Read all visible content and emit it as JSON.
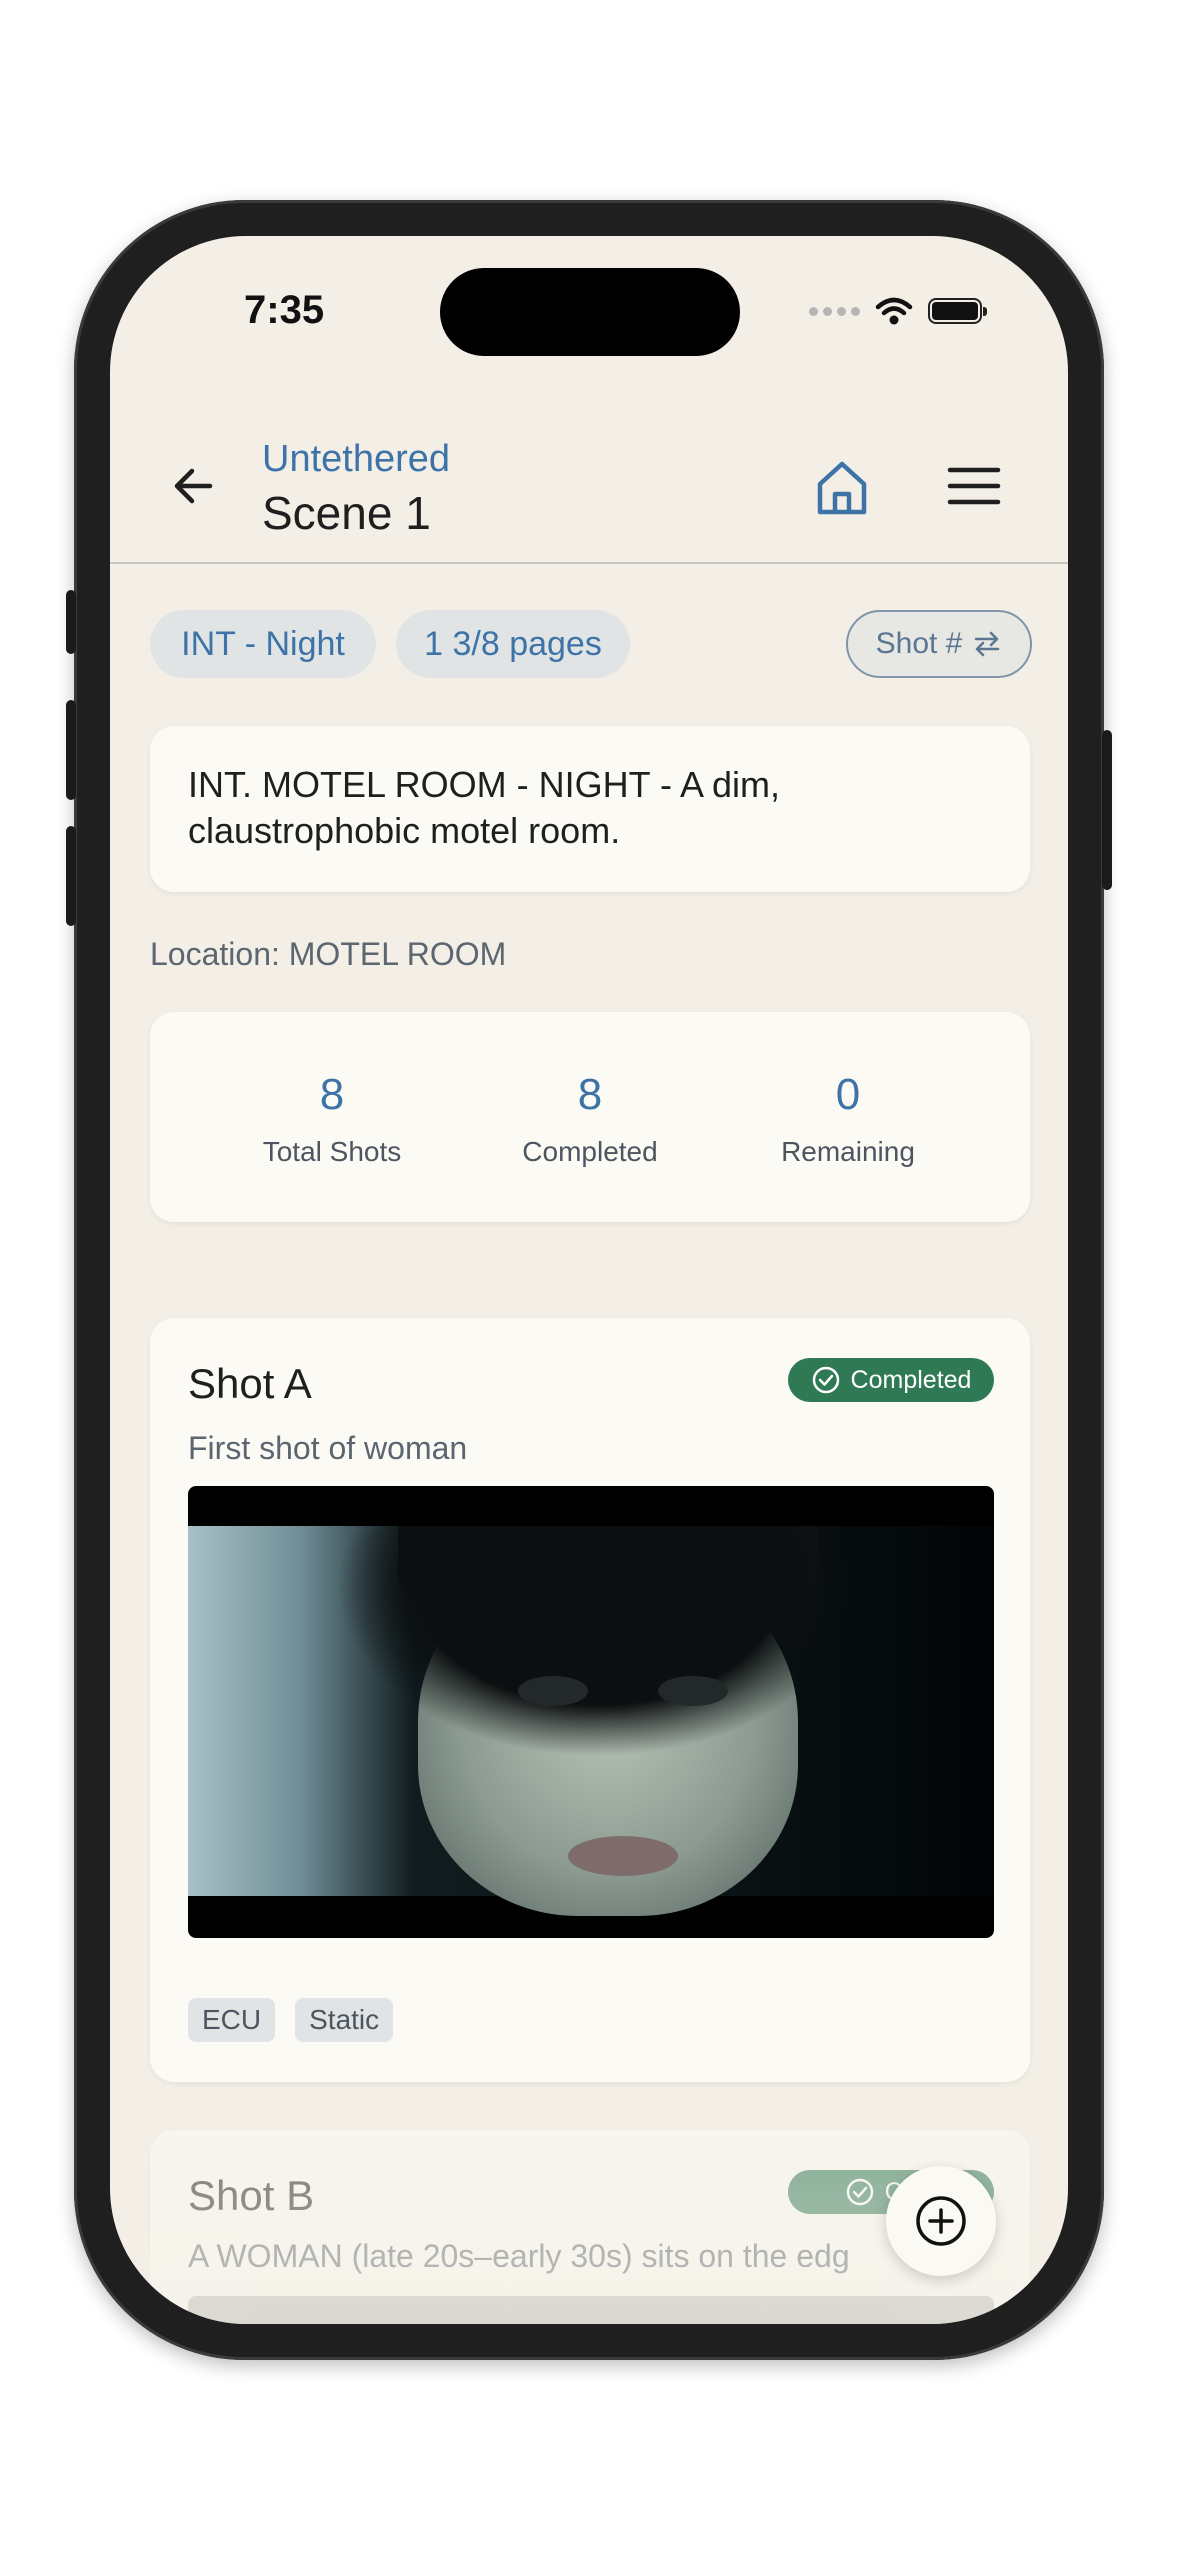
{
  "status_bar": {
    "time": "7:35"
  },
  "header": {
    "project_title": "Untethered",
    "scene_title": "Scene 1",
    "back_icon": "arrow-left-icon",
    "home_icon": "home-icon",
    "menu_icon": "hamburger-menu-icon"
  },
  "chips": {
    "time_of_day": "INT - Night",
    "page_count": "1 3/8 pages",
    "shot_sort_label": "Shot #"
  },
  "scene": {
    "description": "INT. MOTEL ROOM - NIGHT - A dim, claustrophobic motel room.",
    "location": "Location: MOTEL ROOM"
  },
  "stats": {
    "total_value": "8",
    "total_label": "Total Shots",
    "completed_value": "8",
    "completed_label": "Completed",
    "remaining_value": "0",
    "remaining_label": "Remaining"
  },
  "shots": [
    {
      "title": "Shot A",
      "description": "First shot of woman",
      "status": "Completed",
      "tags": [
        "ECU",
        "Static"
      ]
    },
    {
      "title": "Shot B",
      "description": "A WOMAN (late 20s–early 30s) sits on the edg",
      "status": "Com"
    }
  ],
  "colors": {
    "accent_blue": "#3e73a8",
    "completed_green": "#2f7a55",
    "background": "#f3efe6",
    "card": "#fcfaf4"
  }
}
